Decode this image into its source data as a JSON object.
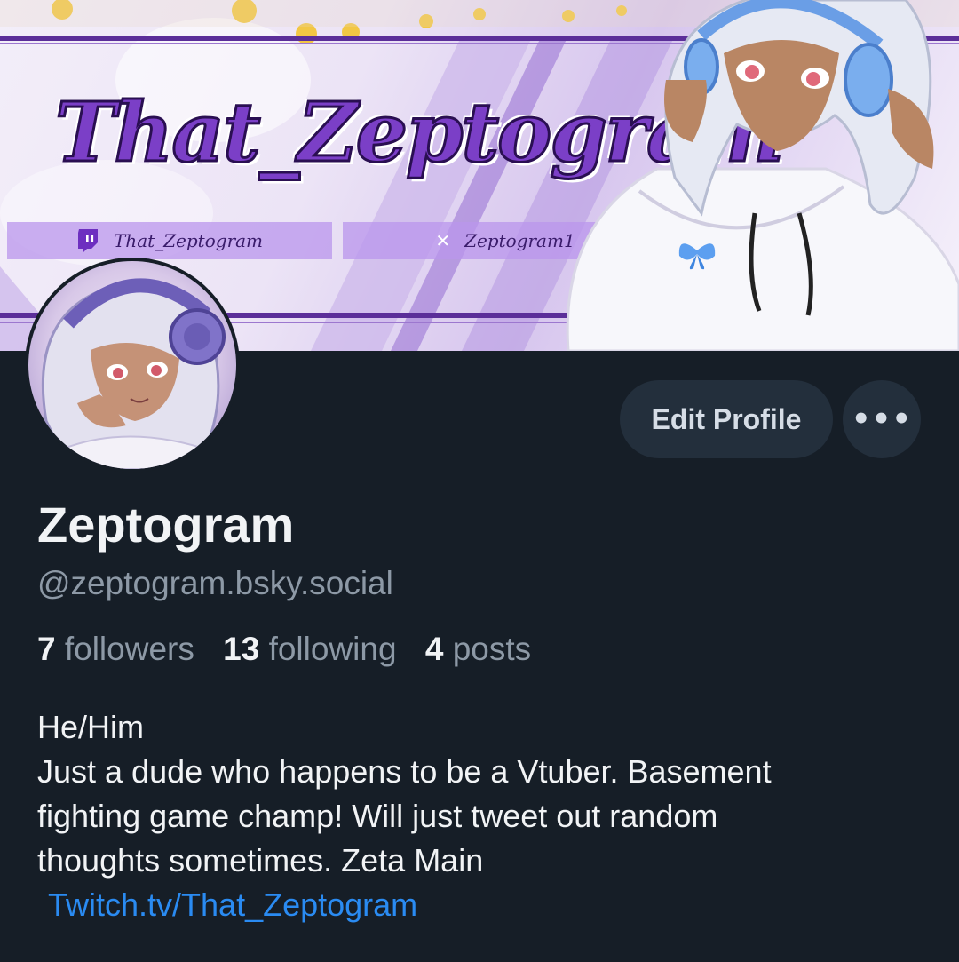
{
  "banner": {
    "title": "That_Zeptogram",
    "twitch_handle": "That_Zeptogram",
    "x_handle": "Zeptogram1",
    "accent_color": "#7b3fc7",
    "stripe_color": "#5b2e99"
  },
  "profile": {
    "display_name": "Zeptogram",
    "handle": "@zeptogram.bsky.social",
    "stats": {
      "followers_count": "7",
      "followers_label": "followers",
      "following_count": "13",
      "following_label": "following",
      "posts_count": "4",
      "posts_label": "posts"
    },
    "bio": {
      "line1": "He/Him",
      "line2": "Just a dude who happens to be a Vtuber. Basement",
      "line3": "fighting game champ! Will just tweet out random",
      "line4": "thoughts sometimes. Zeta Main",
      "link_text": "Twitch.tv/That_Zeptogram"
    }
  },
  "actions": {
    "edit_profile_label": "Edit Profile",
    "more_label": "•••"
  },
  "icons": {
    "twitch": "twitch-icon",
    "x": "x-logo-icon",
    "more": "ellipsis-icon"
  },
  "colors": {
    "background": "#161e27",
    "button_bg": "#232f3c",
    "muted_text": "#8d99a6",
    "link": "#2a8bf2"
  }
}
